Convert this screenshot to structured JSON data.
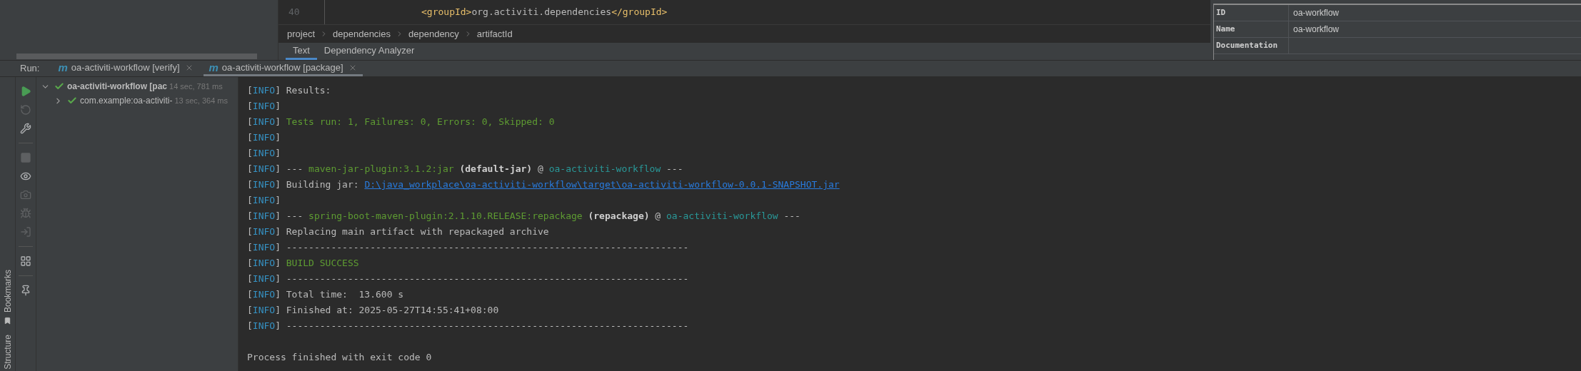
{
  "editor": {
    "line_number": "40",
    "code": [
      {
        "kind": "tag",
        "text": "<groupId>"
      },
      {
        "kind": "text",
        "text": "org.activiti.dependencies"
      },
      {
        "kind": "tag",
        "text": "</groupId>"
      }
    ],
    "breadcrumbs": [
      "project",
      "dependencies",
      "dependency",
      "artifactId"
    ],
    "tabs": [
      {
        "label": "Text",
        "selected": true
      },
      {
        "label": "Dependency Analyzer",
        "selected": false
      }
    ]
  },
  "properties": [
    {
      "label": "ID",
      "value": "oa-workflow"
    },
    {
      "label": "Name",
      "value": "oa-workflow"
    },
    {
      "label": "Documentation"
    }
  ],
  "run_bar": {
    "label": "Run:",
    "tabs": [
      {
        "badge": "m",
        "label": "oa-activiti-workflow [verify]",
        "selected": false
      },
      {
        "badge": "m",
        "label": "oa-activiti-workflow [package]",
        "selected": true
      }
    ]
  },
  "side_stripe": [
    "Bookmarks",
    "Structure"
  ],
  "toolbar": [
    {
      "kind": "run",
      "disabled": false
    },
    {
      "kind": "rerun",
      "disabled": true
    },
    {
      "kind": "wrench",
      "disabled": false
    },
    {
      "kind": "divider"
    },
    {
      "kind": "stop",
      "disabled": true
    },
    {
      "kind": "eye",
      "disabled": false
    },
    {
      "kind": "camera",
      "disabled": true
    },
    {
      "kind": "bug",
      "disabled": true
    },
    {
      "kind": "import",
      "disabled": true
    },
    {
      "kind": "divider"
    },
    {
      "kind": "layout",
      "disabled": false
    },
    {
      "kind": "divider"
    },
    {
      "kind": "pin",
      "disabled": false
    }
  ],
  "tree": [
    {
      "label": "oa-activiti-workflow [pac",
      "time": "14 sec, 781 ms",
      "passed": true,
      "expanded": true,
      "children": [
        {
          "label": "com.example:oa-activiti-",
          "time": "13 sec, 364 ms",
          "passed": true,
          "expanded": false
        }
      ]
    }
  ],
  "console": [
    [
      {
        "kind": "plain",
        "text": "["
      },
      {
        "kind": "level",
        "text": "INFO"
      },
      {
        "kind": "plain",
        "text": "] Results:"
      }
    ],
    [
      {
        "kind": "plain",
        "text": "["
      },
      {
        "kind": "level",
        "text": "INFO"
      },
      {
        "kind": "plain",
        "text": "]"
      }
    ],
    [
      {
        "kind": "plain",
        "text": "["
      },
      {
        "kind": "level",
        "text": "INFO"
      },
      {
        "kind": "plain",
        "text": "] "
      },
      {
        "kind": "success",
        "text": "Tests run: 1, Failures: 0, Errors: 0, Skipped: 0"
      }
    ],
    [
      {
        "kind": "plain",
        "text": "["
      },
      {
        "kind": "level",
        "text": "INFO"
      },
      {
        "kind": "plain",
        "text": "]"
      }
    ],
    [
      {
        "kind": "plain",
        "text": "["
      },
      {
        "kind": "level",
        "text": "INFO"
      },
      {
        "kind": "plain",
        "text": "]"
      }
    ],
    [
      {
        "kind": "plain",
        "text": "["
      },
      {
        "kind": "level",
        "text": "INFO"
      },
      {
        "kind": "plain",
        "text": "] --- "
      },
      {
        "kind": "success",
        "text": "maven-jar-plugin:3.1.2:jar"
      },
      {
        "kind": "bold",
        "text": " (default-jar)"
      },
      {
        "kind": "plain",
        "text": " @ "
      },
      {
        "kind": "module",
        "text": "oa-activiti-workflow"
      },
      {
        "kind": "plain",
        "text": " ---"
      }
    ],
    [
      {
        "kind": "plain",
        "text": "["
      },
      {
        "kind": "level",
        "text": "INFO"
      },
      {
        "kind": "plain",
        "text": "] Building jar: "
      },
      {
        "kind": "link",
        "text": "D:\\java_workplace\\oa-activiti-workflow\\target\\oa-activiti-workflow-0.0.1-SNAPSHOT.jar"
      }
    ],
    [
      {
        "kind": "plain",
        "text": "["
      },
      {
        "kind": "level",
        "text": "INFO"
      },
      {
        "kind": "plain",
        "text": "]"
      }
    ],
    [
      {
        "kind": "plain",
        "text": "["
      },
      {
        "kind": "level",
        "text": "INFO"
      },
      {
        "kind": "plain",
        "text": "] --- "
      },
      {
        "kind": "success",
        "text": "spring-boot-maven-plugin:2.1.10.RELEASE:repackage"
      },
      {
        "kind": "bold",
        "text": " (repackage)"
      },
      {
        "kind": "plain",
        "text": " @ "
      },
      {
        "kind": "module",
        "text": "oa-activiti-workflow"
      },
      {
        "kind": "plain",
        "text": " ---"
      }
    ],
    [
      {
        "kind": "plain",
        "text": "["
      },
      {
        "kind": "level",
        "text": "INFO"
      },
      {
        "kind": "plain",
        "text": "] Replacing main artifact with repackaged archive"
      }
    ],
    [
      {
        "kind": "plain",
        "text": "["
      },
      {
        "kind": "level",
        "text": "INFO"
      },
      {
        "kind": "plain",
        "text": "] ------------------------------------------------------------------------"
      }
    ],
    [
      {
        "kind": "plain",
        "text": "["
      },
      {
        "kind": "level",
        "text": "INFO"
      },
      {
        "kind": "plain",
        "text": "] "
      },
      {
        "kind": "success",
        "text": "BUILD SUCCESS"
      }
    ],
    [
      {
        "kind": "plain",
        "text": "["
      },
      {
        "kind": "level",
        "text": "INFO"
      },
      {
        "kind": "plain",
        "text": "] ------------------------------------------------------------------------"
      }
    ],
    [
      {
        "kind": "plain",
        "text": "["
      },
      {
        "kind": "level",
        "text": "INFO"
      },
      {
        "kind": "plain",
        "text": "] Total time:  13.600 s"
      }
    ],
    [
      {
        "kind": "plain",
        "text": "["
      },
      {
        "kind": "level",
        "text": "INFO"
      },
      {
        "kind": "plain",
        "text": "] Finished at: 2025-05-27T14:55:41+08:00"
      }
    ],
    [
      {
        "kind": "plain",
        "text": "["
      },
      {
        "kind": "level",
        "text": "INFO"
      },
      {
        "kind": "plain",
        "text": "] ------------------------------------------------------------------------"
      }
    ]
  ],
  "exit_message": "Process finished with exit code 0"
}
